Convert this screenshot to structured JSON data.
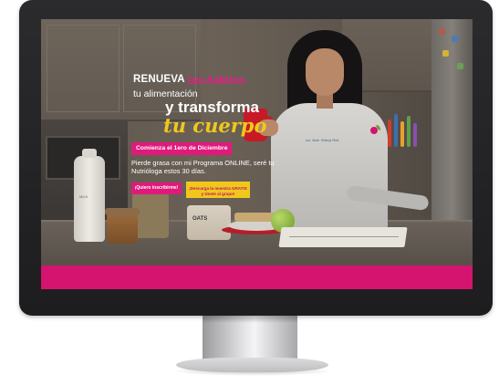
{
  "hero": {
    "line1_bold": "RENUEVA",
    "line1_script": "tus hábitos,",
    "line2": "tu alimentación",
    "line3": "y transforma",
    "line4": "tu cuerpo",
    "date_badge": "Comienza el 1ero de Diciembre",
    "description": "Pierde grasa con mi Programa ONLINE, seré tu Nutrióloga estos 30 días.",
    "subscribe_button": "¡Quiero inscribirme!",
    "download_button": "¡Descarga la muestra GRATIS y Únete al grupo!"
  },
  "scene": {
    "coat_name": "Lic. Nutr. Sheryl Rdz",
    "milk_label": "MILK",
    "oats_label": "OATS"
  },
  "colors": {
    "accent_pink": "#e01a7c",
    "accent_yellow": "#f0c81c",
    "bottom_band": "#d4146e"
  }
}
